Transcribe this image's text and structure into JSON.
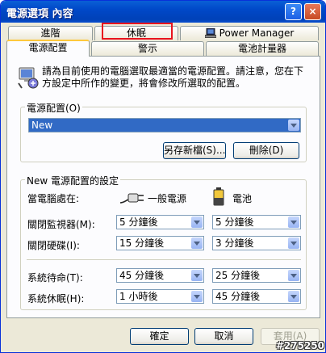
{
  "window": {
    "title": "電源選項 內容",
    "help_label": "?",
    "close_label": "×"
  },
  "tabs_back": [
    {
      "label": "進階"
    },
    {
      "label": "休眠"
    },
    {
      "label": "Power Manager"
    }
  ],
  "tabs_front": [
    {
      "label": "電源配置"
    },
    {
      "label": "警示"
    },
    {
      "label": "電池計量器"
    }
  ],
  "description": "請為目前使用的電腦選取最適當的電源配置。請注意，您在下方設定中所作的變更，將會修改所選取的配置。",
  "scheme": {
    "group_label": "電源配置(O)",
    "selected": "New",
    "save_as_label": "另存新檔(S)...",
    "delete_label": "刪除(D)"
  },
  "settings": {
    "group_label": "New 電源配置的設定",
    "when_label": "當電腦處在:",
    "ac_label": "一般電源",
    "battery_label": "電池",
    "rows": [
      {
        "label": "關閉監視器(M):",
        "ac": "5 分鐘後",
        "battery": "5 分鐘後"
      },
      {
        "label": "關閉硬碟(I):",
        "ac": "15 分鐘後",
        "battery": "3 分鐘後"
      },
      {
        "label": "系統待命(T):",
        "ac": "45 分鐘後",
        "battery": "25 分鐘後"
      },
      {
        "label": "系統休眠(H):",
        "ac": "1 小時後",
        "battery": "45 分鐘後"
      }
    ]
  },
  "footer": {
    "ok_label": "確定",
    "cancel_label": "取消",
    "apply_label": "套用(A)"
  },
  "watermark": "#275250"
}
